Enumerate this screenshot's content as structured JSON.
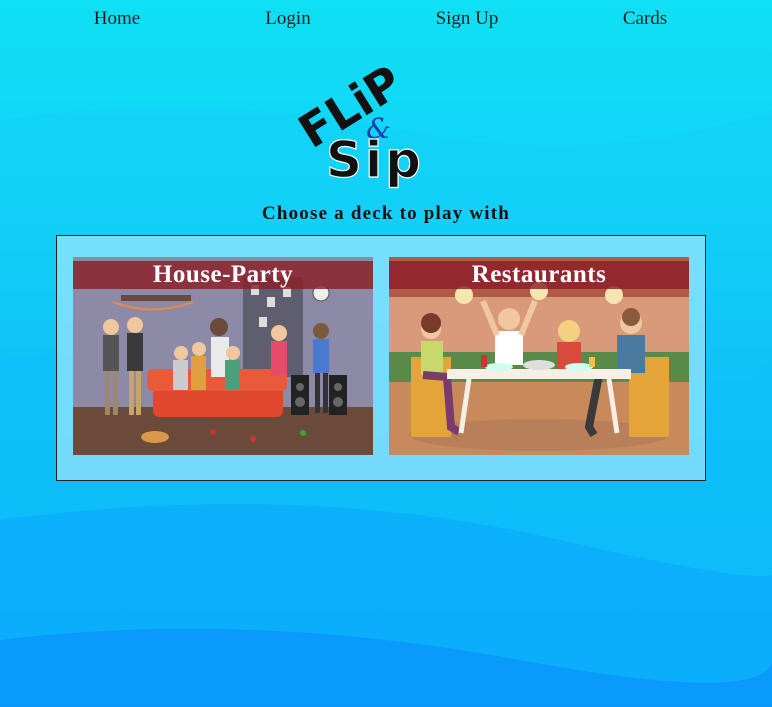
{
  "nav": {
    "items": [
      {
        "label": "Home"
      },
      {
        "label": "Login"
      },
      {
        "label": "Sign Up"
      },
      {
        "label": "Cards"
      }
    ]
  },
  "logo": {
    "top_text": "FLiP",
    "amp_text": "&",
    "bottom_text": "Sip"
  },
  "heading": "Choose a deck to play with",
  "decks": [
    {
      "title": "House-Party",
      "image": "house-party-illustration"
    },
    {
      "title": "Restaurants",
      "image": "restaurant-dinner-illustration"
    }
  ],
  "colors": {
    "background_top": "#0fe0f5",
    "background_bottom": "#0a93fb",
    "card_title_bar": "#8c1e28"
  }
}
